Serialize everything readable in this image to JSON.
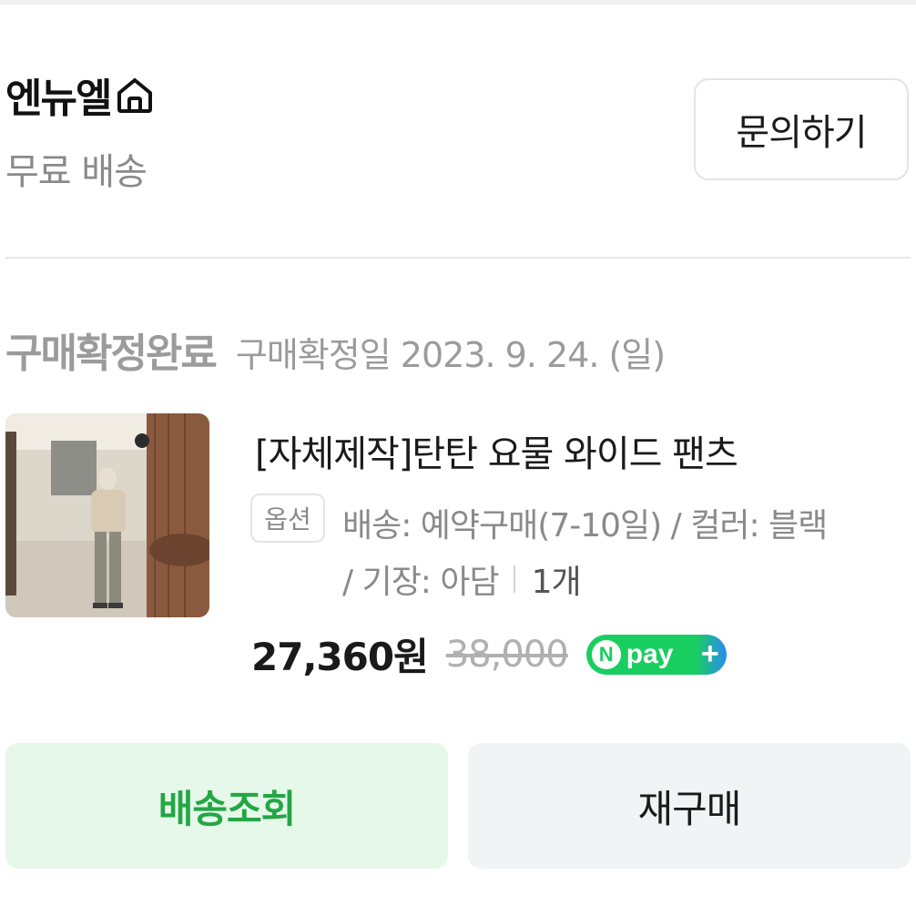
{
  "store": {
    "name": "엔뉴엘",
    "shipping": "무료 배송",
    "inquiry_label": "문의하기"
  },
  "order": {
    "status": "구매확정완료",
    "confirm_date": "구매확정일 2023. 9. 24. (일)",
    "product_title": "[자체제작]탄탄 요물 와이드 팬츠",
    "option_badge": "옵션",
    "option_line1": "배송: 예약구매(7-10일) / 컬러: 블랙",
    "option_line2": "/ 기장: 아담",
    "quantity": "1개",
    "price": "27,360원",
    "original_price": "38,000",
    "npay_text": "pay",
    "npay_n": "N",
    "npay_plus": "+"
  },
  "actions": {
    "track_label": "배송조회",
    "rebuy_label": "재구매"
  },
  "colors": {
    "accent_green": "#24a645",
    "track_bg": "#e6f8ea",
    "npay_green": "#19ce60",
    "npay_blue": "#2a8cf0"
  },
  "icons": {
    "store_home": "home-icon"
  }
}
